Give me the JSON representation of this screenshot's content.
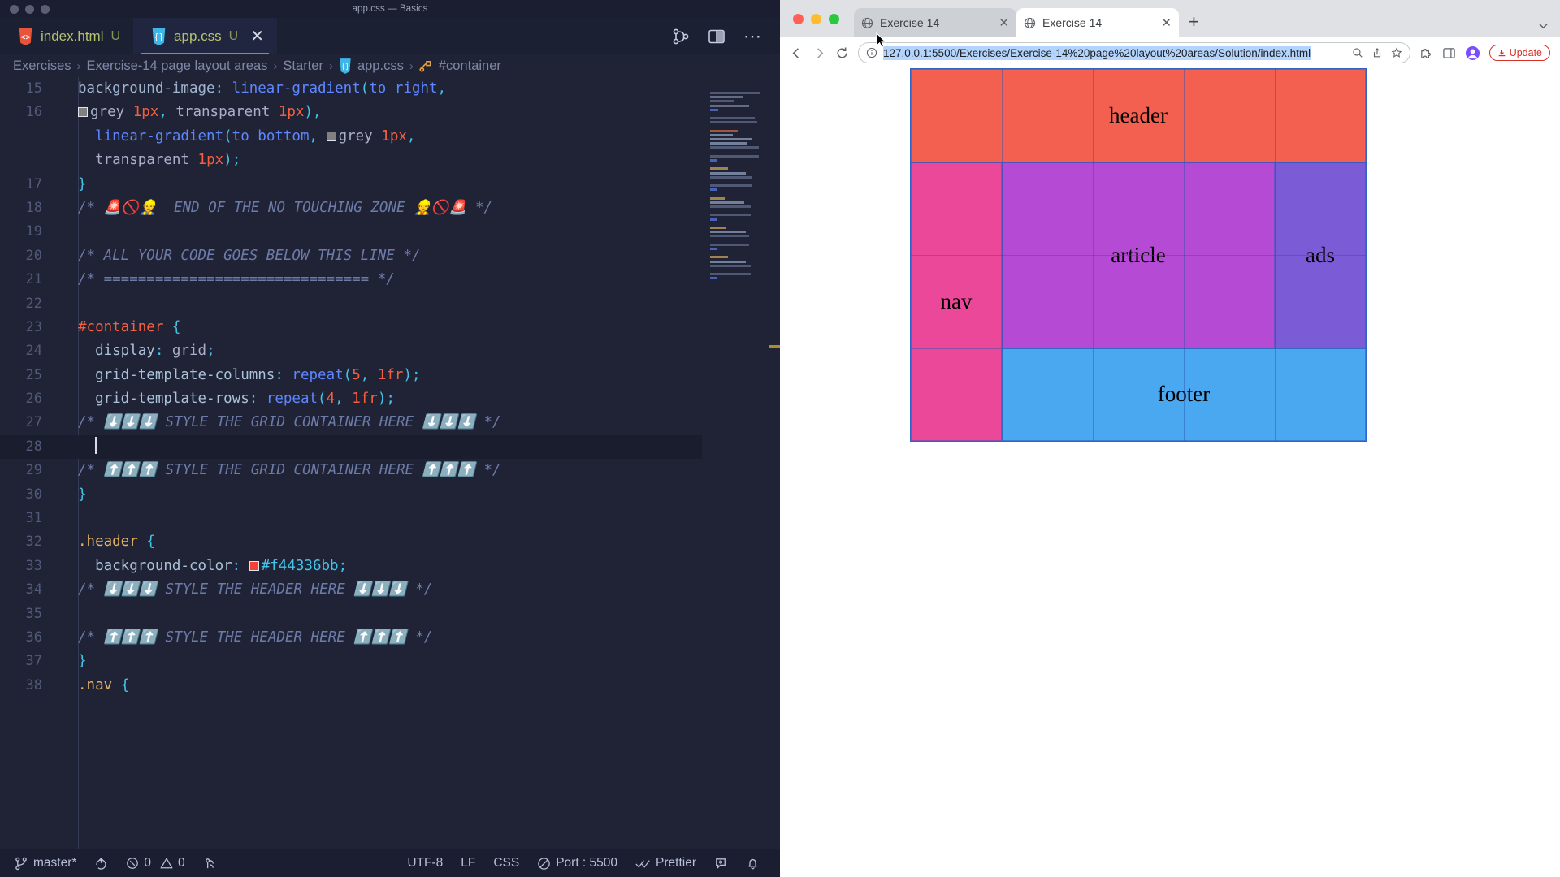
{
  "vscode": {
    "window_title": "app.css — Basics",
    "tabs": [
      {
        "label": "index.html",
        "badge": "U",
        "icon": "html5-icon",
        "active": false,
        "closable": false
      },
      {
        "label": "app.css",
        "badge": "U",
        "icon": "css3-icon",
        "active": true,
        "closable": true,
        "close_glyph": "✕"
      }
    ],
    "toolbar_icons": [
      "source-control-graph-icon",
      "split-editor-icon",
      "more-actions-icon"
    ],
    "breadcrumb": [
      "Exercises",
      "Exercise-14 page layout areas",
      "Starter",
      "app.css",
      "#container"
    ],
    "breadcrumb_separator": "›",
    "editor": {
      "lines": [
        {
          "n": "15",
          "current": false
        },
        {
          "n": "16",
          "current": false
        },
        {
          "n": "17",
          "current": false
        },
        {
          "n": "18",
          "current": false
        },
        {
          "n": "19",
          "current": false
        },
        {
          "n": "20",
          "current": false
        },
        {
          "n": "21",
          "current": false
        },
        {
          "n": "22",
          "current": false
        },
        {
          "n": "23",
          "current": false
        },
        {
          "n": "24",
          "current": false
        },
        {
          "n": "25",
          "current": false
        },
        {
          "n": "26",
          "current": false
        },
        {
          "n": "27",
          "current": false
        },
        {
          "n": "28",
          "current": true
        },
        {
          "n": "29",
          "current": false
        },
        {
          "n": "30",
          "current": false
        },
        {
          "n": "31",
          "current": false
        },
        {
          "n": "32",
          "current": false
        },
        {
          "n": "33",
          "current": false
        },
        {
          "n": "34",
          "current": false
        },
        {
          "n": "35",
          "current": false
        },
        {
          "n": "36",
          "current": false
        },
        {
          "n": "37",
          "current": false
        },
        {
          "n": "38",
          "current": false
        }
      ],
      "code": {
        "l15": "background-image: linear-gradient(to right,",
        "l15_prop": "background-image",
        "l15_fn": "linear-gradient",
        "l15_kw": "to right",
        "l16a_val": "grey",
        "l16a_num": "1px",
        "l16a_val2": "transparent",
        "l16a_num2": "1px",
        "l16b_fn": "linear-gradient",
        "l16b_kw": "to bottom",
        "l16b_val": "grey",
        "l16b_num": "1px",
        "l16c_val": "transparent",
        "l16c_num": "1px",
        "l17": "}",
        "l18_comment": "/* 🚨🚫👷  END OF THE NO TOUCHING ZONE 👷🚫🚨 */",
        "l20_comment": "/* ALL YOUR CODE GOES BELOW THIS LINE */",
        "l21_comment": "/* =============================== */",
        "l23_selector": "#container",
        "l23_brace": "{",
        "l24_prop": "display",
        "l24_val": "grid",
        "l25_prop": "grid-template-columns",
        "l25_fn": "repeat",
        "l25_num1": "5",
        "l25_num2": "1fr",
        "l26_prop": "grid-template-rows",
        "l26_fn": "repeat",
        "l26_num1": "4",
        "l26_num2": "1fr",
        "l27_comment": "/* ⬇️⬇️⬇️ STYLE THE GRID CONTAINER HERE ⬇️⬇️⬇️ */",
        "l29_comment": "/* ⬆️⬆️⬆️ STYLE THE GRID CONTAINER HERE ⬆️⬆️⬆️ */",
        "l30_brace": "}",
        "l32_selector": ".header",
        "l32_brace": "{",
        "l33_prop": "background-color",
        "l33_hex": "#f44336bb",
        "l33_swatch_color": "#f44336",
        "l34_comment": "/* ⬇️⬇️⬇️ STYLE THE HEADER HERE ⬇️⬇️⬇️ */",
        "l36_comment": "/* ⬆️⬆️⬆️ STYLE THE HEADER HERE ⬆️⬆️⬆️ */",
        "l37_brace": "}",
        "l38_selector": ".nav",
        "l38_brace": "{"
      }
    },
    "statusbar": {
      "branch": "master*",
      "sync_icon": "sync-changes-icon",
      "errors": "0",
      "warnings": "0",
      "ports_icon": "radio-tower-icon",
      "encoding": "UTF-8",
      "eol": "LF",
      "language": "CSS",
      "liveserver": "Port : 5500",
      "formatter": "Prettier",
      "feedback_icon": "feedback-icon",
      "bell_icon": "bell-icon"
    }
  },
  "browser": {
    "tabs": [
      {
        "title": "Exercise 14",
        "active": false
      },
      {
        "title": "Exercise 14",
        "active": true
      }
    ],
    "new_tab_glyph": "+",
    "tab_close_glyph": "✕",
    "url": "127.0.0.1:5500/Exercises/Exercise-14%20page%20layout%20areas/Solution/index.html",
    "update_label": "Update",
    "nav": {
      "back": "back-arrow-icon",
      "forward": "forward-arrow-icon",
      "reload": "reload-icon"
    },
    "omnibox_icons": [
      "info-circle-icon",
      "search-icon",
      "share-icon",
      "bookmark-star-icon"
    ],
    "toolbar_icons": [
      "extensions-puzzle-icon",
      "side-panel-icon",
      "profile-avatar-icon"
    ]
  },
  "page": {
    "grid": {
      "columns": 5,
      "rows": 4,
      "areas": [
        {
          "name": "header",
          "label": "header",
          "color": "#f4604f",
          "col_start": 1,
          "col_end": 6,
          "row_start": 1,
          "row_end": 2
        },
        {
          "name": "nav",
          "label": "nav",
          "color": "#ec4899",
          "col_start": 1,
          "col_end": 2,
          "row_start": 2,
          "row_end": 5
        },
        {
          "name": "article",
          "label": "article",
          "color": "#b54bd4",
          "col_start": 2,
          "col_end": 5,
          "row_start": 2,
          "row_end": 4
        },
        {
          "name": "ads",
          "label": "ads",
          "color": "#7b5bd6",
          "col_start": 5,
          "col_end": 6,
          "row_start": 2,
          "row_end": 4
        },
        {
          "name": "footer",
          "label": "footer",
          "color": "#4aa8f0",
          "col_start": 2,
          "col_end": 6,
          "row_start": 4,
          "row_end": 5
        }
      ]
    }
  }
}
